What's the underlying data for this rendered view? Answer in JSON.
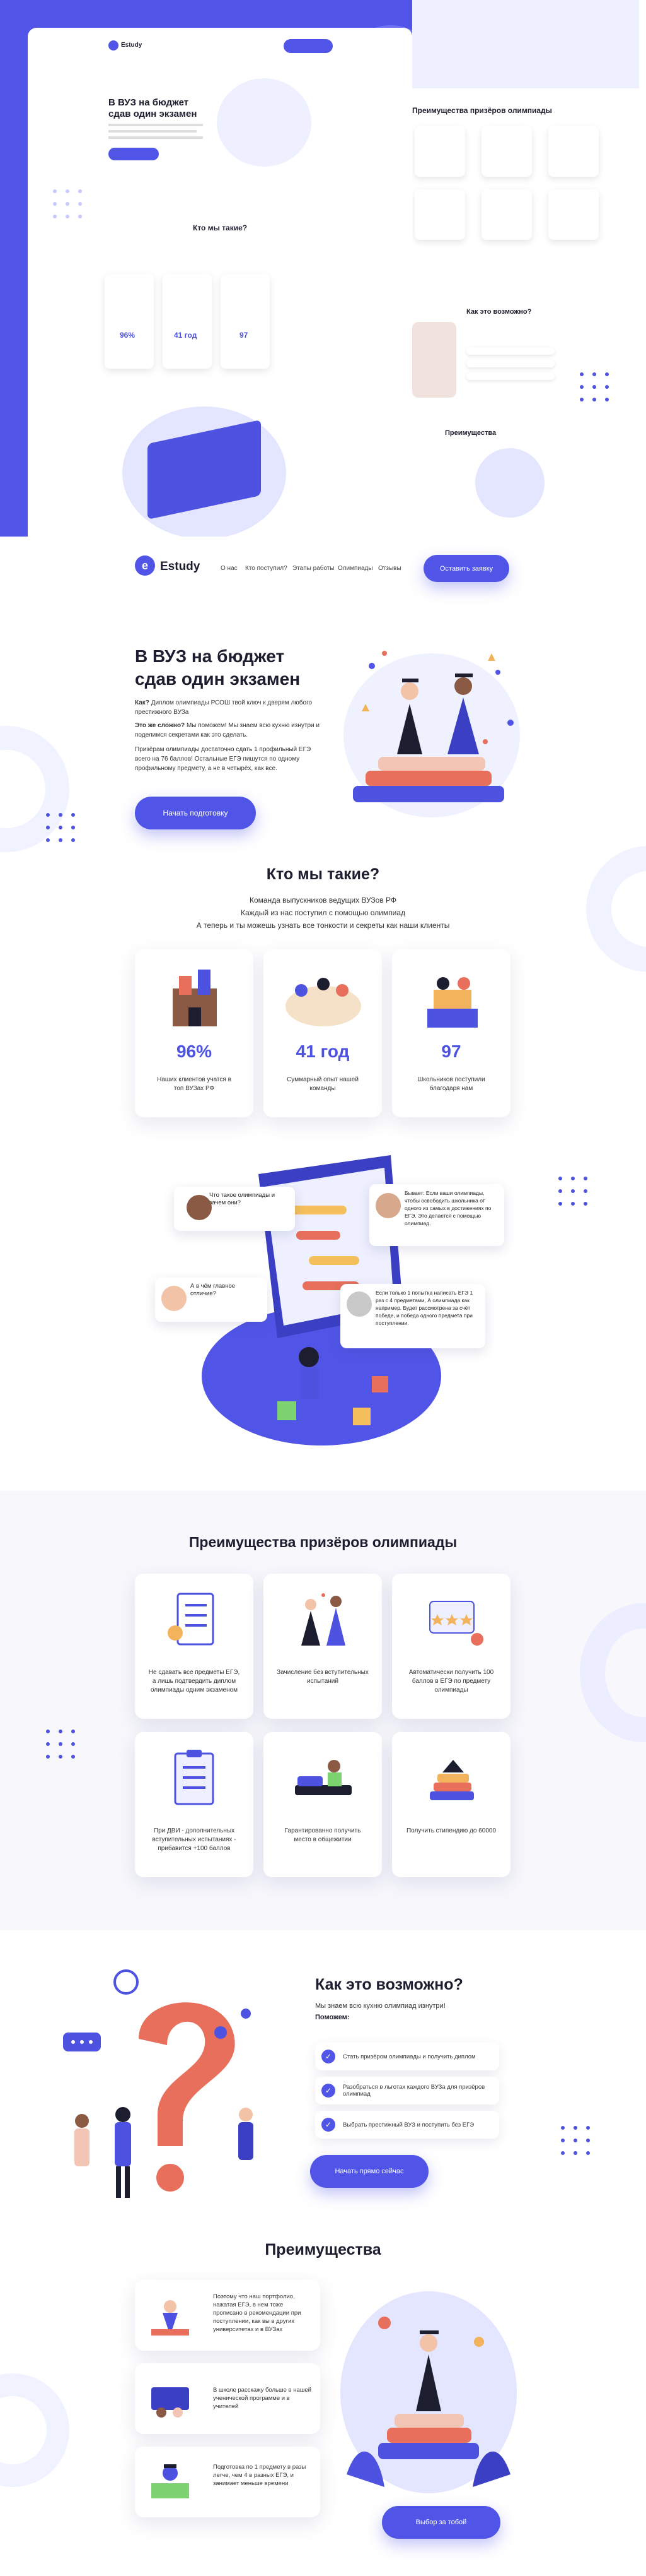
{
  "brand": {
    "name": "Estudy",
    "accent": "#5055e8",
    "dark": "#1c1d2e"
  },
  "nav": {
    "items": [
      "О нас",
      "Кто поступил?",
      "Этапы работы",
      "Олимпиады",
      "Отзывы"
    ],
    "cta": "Оставить заявку"
  },
  "hero": {
    "title_line1": "В ВУЗ на бюджет",
    "title_line2": "сдав один экзамен",
    "p1_label": "Как?",
    "p1": "Диплом олимпиады РСОШ твой ключ к дверям любого престижного ВУЗа",
    "p2_label": "Это же сложно?",
    "p2": "Мы поможем! Мы знаем всю кухню изнутри и поделимся секретами как это сделать.",
    "p3": "Призёрам олимпиады достаточно сдать 1 профильный ЕГЭ всего на 76 баллов! Остальные ЕГЭ пишутся по одному профильному предмету, а не в четырёх, как все.",
    "cta": "Начать подготовку"
  },
  "about": {
    "title": "Кто мы такие?",
    "sub1": "Команда выпускников ведущих ВУЗов РФ",
    "sub2": "Каждый из нас поступил с помощью олимпиад",
    "sub3": "А теперь и ты можешь узнать все тонкости и секреты как наши клиенты",
    "stats": [
      {
        "value": "96%",
        "caption": "Наших клиентов учатся в топ ВУЗах РФ"
      },
      {
        "value": "41 год",
        "caption": "Суммарный опыт нашей команды"
      },
      {
        "value": "97",
        "caption": "Школьников поступили благодаря нам"
      }
    ]
  },
  "chat": {
    "q1": "Что такое олимпиады и зачем они?",
    "q2": "А в чём главное отличие?",
    "a1": "Бывает: Если ваши олимпиады, чтобы освободить школьника от одного из самых в достижениях по ЕГЭ. Это делается с помощью олимпиад.",
    "a2": "Если только 1 попытка написать ЕГЭ 1 раз с 4 предметами, А олимпиада как например. Будет рассмотрена за счёт победе, и победа одного предмета при поступлении."
  },
  "benefits": {
    "title": "Преимущества призёров олимпиады",
    "items": [
      "Не сдавать все предметы ЕГЭ, а лишь подтвердить диплом олимпиады одним экзаменом",
      "Зачисление без вступительных испытаний",
      "Автоматически получить 100 баллов в ЕГЭ по предмету олимпиады",
      "При ДВИ - дополнительных вступительных испытаниях - прибавится +100 баллов",
      "Гарантированно получить место в общежитии",
      "Получить стипендию до 60000"
    ]
  },
  "how": {
    "title": "Как это возможно?",
    "sub1": "Мы знаем всю кухню олимпиад изнутри!",
    "sub2": "Поможем:",
    "items": [
      "Стать призёром олимпиады и получить диплом",
      "Разобраться в льготах каждого ВУЗа для призёров олимпиад",
      "Выбрать престижный ВУЗ и поступить без ЕГЭ"
    ],
    "cta": "Начать прямо сейчас"
  },
  "adv": {
    "title": "Преимущества",
    "items": [
      "Поэтому что наш портфолио, нажатая ЕГЭ, в нем тоже прописано в рекомендации при поступлении, как вы в других университетах и в ВУЗах",
      "В школе расскажу больше в нашей ученической программе и в учителей",
      "Подготовка по 1 предмету в разы легче, чем 4 в разных ЕГЭ, и занимает меньше времени"
    ],
    "cta": "Выбор за тобой"
  },
  "preview": {
    "hero_title_line1": "В ВУЗ на бюджет",
    "hero_title_line2": "сдав один экзамен",
    "about_title": "Кто мы такие?",
    "stats": [
      "96%",
      "41 год",
      "97"
    ],
    "benefits_title": "Преимущества призёров олимпиады",
    "how_title": "Как это возможно?",
    "adv_title": "Преимущества"
  }
}
